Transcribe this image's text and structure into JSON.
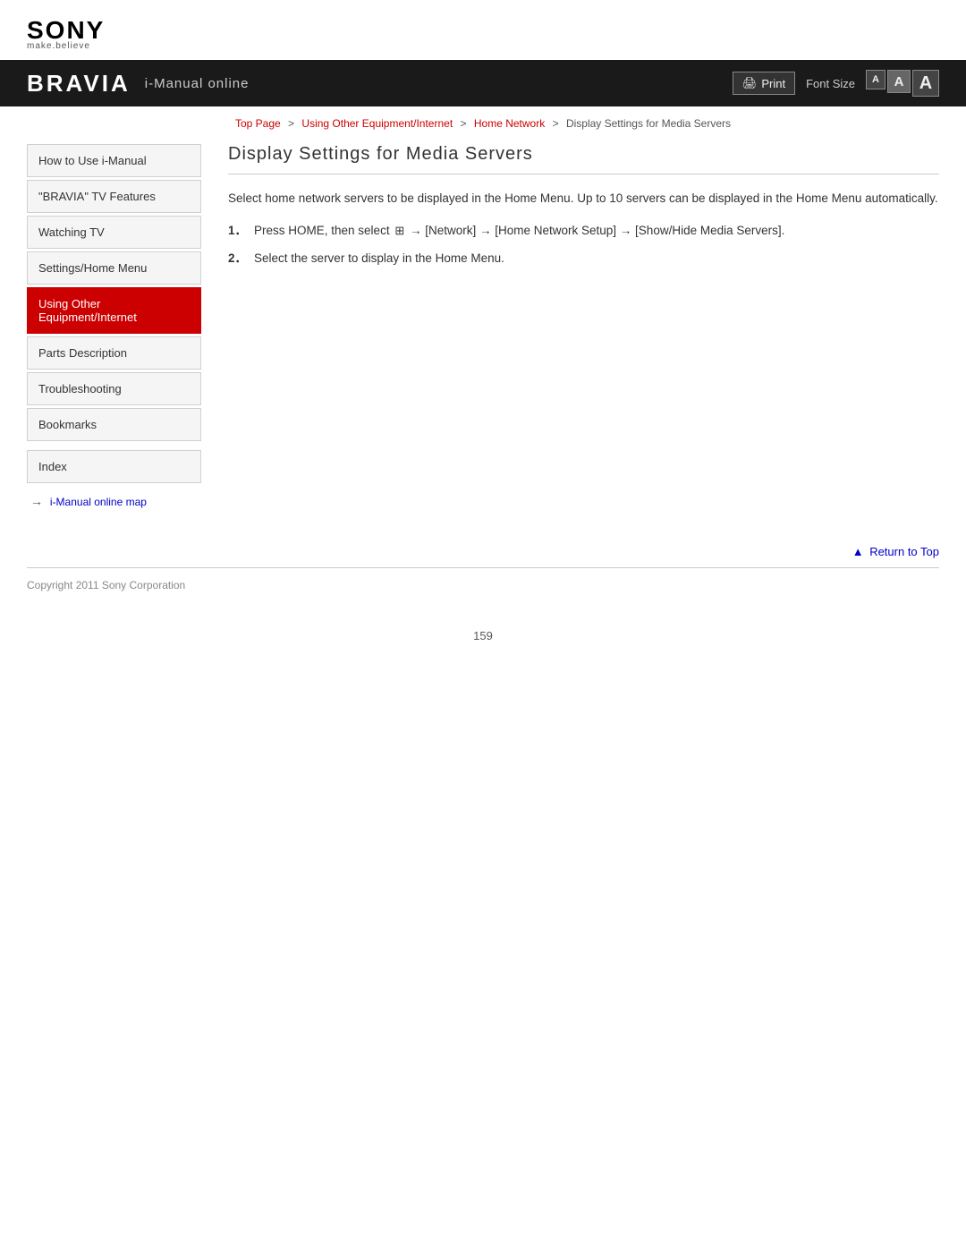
{
  "logo": {
    "name": "SONY",
    "tagline": "make.believe"
  },
  "topbar": {
    "bravia": "BRAVIA",
    "subtitle": "i-Manual online",
    "print_label": "Print",
    "font_size_label": "Font Size",
    "font_small": "A",
    "font_medium": "A",
    "font_large": "A"
  },
  "breadcrumb": {
    "items": [
      {
        "label": "Top Page",
        "link": true
      },
      {
        "label": "Using Other Equipment/Internet",
        "link": true
      },
      {
        "label": "Home Network",
        "link": true
      },
      {
        "label": "Display Settings for Media Servers",
        "link": false
      }
    ]
  },
  "sidebar": {
    "items": [
      {
        "id": "how-to-use",
        "label": "How to Use i-Manual",
        "active": false
      },
      {
        "id": "bravia-tv",
        "label": "\"BRAVIA\" TV Features",
        "active": false
      },
      {
        "id": "watching-tv",
        "label": "Watching TV",
        "active": false
      },
      {
        "id": "settings-home",
        "label": "Settings/Home Menu",
        "active": false
      },
      {
        "id": "using-other",
        "label": "Using Other Equipment/Internet",
        "active": true
      },
      {
        "id": "parts-description",
        "label": "Parts Description",
        "active": false
      },
      {
        "id": "troubleshooting",
        "label": "Troubleshooting",
        "active": false
      },
      {
        "id": "bookmarks",
        "label": "Bookmarks",
        "active": false
      }
    ],
    "index_label": "Index",
    "map_link_label": "i-Manual online map"
  },
  "content": {
    "title": "Display Settings for Media Servers",
    "intro": "Select home network servers to be displayed in the Home Menu. Up to 10 servers can be displayed in the Home Menu automatically.",
    "steps": [
      {
        "num": "1.",
        "text_before": "Press HOME, then select ",
        "icon": "⊞",
        "text_after": "→ [Network] → [Home Network Setup] → [Show/Hide Media Servers]."
      },
      {
        "num": "2.",
        "text": "Select the server to display in the Home Menu."
      }
    ]
  },
  "return_top": {
    "label": "Return to Top"
  },
  "footer": {
    "copyright": "Copyright 2011 Sony Corporation"
  },
  "page_number": "159"
}
